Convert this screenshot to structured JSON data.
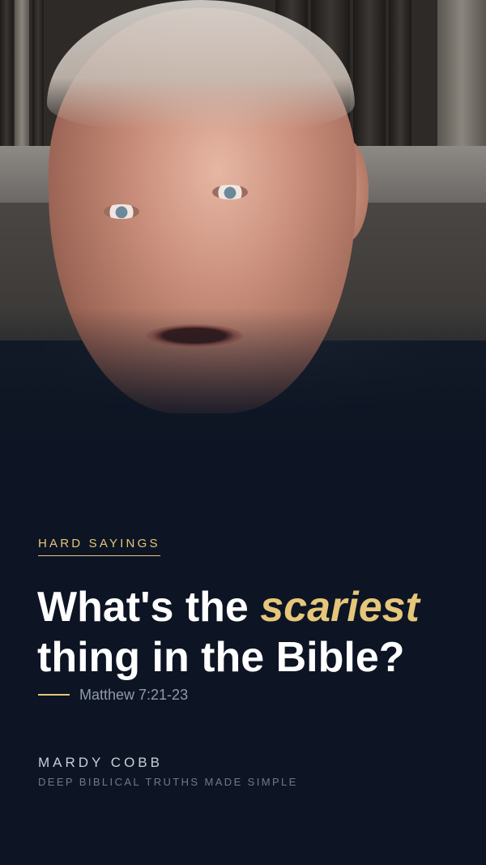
{
  "category": {
    "label": "HARD SAYINGS"
  },
  "title": {
    "part1": "What's the ",
    "accent": "scariest",
    "part2": "thing in the Bible?"
  },
  "reference": {
    "text": "Matthew 7:21-23"
  },
  "author": {
    "name": "MARDY COBB",
    "tagline": "DEEP BIBLICAL TRUTHS MADE SIMPLE"
  },
  "colors": {
    "background": "#0d1524",
    "accent": "#e6c67a",
    "title": "#ffffff",
    "muted": "#8f9aab"
  }
}
